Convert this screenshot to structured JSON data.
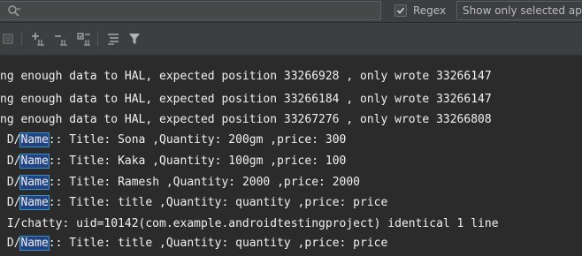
{
  "search": {
    "placeholder": "",
    "value": ""
  },
  "regex": {
    "label": "Regex",
    "checked": true
  },
  "filter": {
    "selected": "Show only selected application"
  },
  "toolbar": {
    "icons": [
      "clear-logcat-icon",
      "soft-wraps-icon",
      "scroll-to-end-icon",
      "restart-icon",
      "print-icon",
      "filter-icon"
    ]
  },
  "log": {
    "lines": [
      {
        "prefix": "ng enough data to HAL, expected position 33266928 , only wrote 33266147",
        "match": "",
        "suffix": ""
      },
      {
        "prefix": "ng enough data to HAL, expected position 33266184 , only wrote 33266147",
        "match": "",
        "suffix": ""
      },
      {
        "prefix": "ng enough data to HAL, expected position 33267276 , only wrote 33266808",
        "match": "",
        "suffix": ""
      },
      {
        "prefix": " D/",
        "match": "Name",
        "suffix": ":: Title: Sona ,Quantity: 200gm ,price: 300"
      },
      {
        "prefix": " D/",
        "match": "Name",
        "suffix": ":: Title: Kaka ,Quantity: 100gm ,price: 100"
      },
      {
        "prefix": " D/",
        "match": "Name",
        "suffix": ":: Title: Ramesh ,Quantity: 2000 ,price: 2000"
      },
      {
        "prefix": " D/",
        "match": "Name",
        "suffix": ":: Title: title ,Quantity: quantity ,price: price"
      },
      {
        "prefix": " I/chatty: uid=10142(com.example.androidtestingproject) identical 1 line",
        "match": "",
        "suffix": ""
      },
      {
        "prefix": " D/",
        "match": "Name",
        "suffix": ":: Title: title ,Quantity: quantity ,price: price"
      }
    ]
  },
  "colors": {
    "background": "#2b2b2b",
    "panel": "#3c3f41",
    "text": "#f0f0f0",
    "match_border": "#3592c4"
  }
}
